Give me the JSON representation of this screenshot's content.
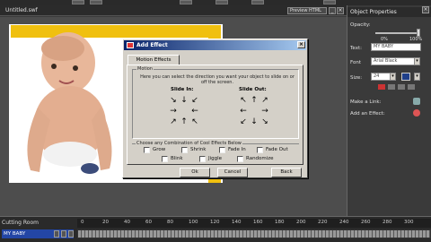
{
  "document": {
    "title": "Untitled.swf",
    "view_menu": "Preview HTML"
  },
  "dialog": {
    "title": "Add Effect",
    "tab": "Motion Effects",
    "motion_group": "Motion",
    "instructions": "Here you can select the direction you want your object to slide on or off the screen.",
    "slide_in": "Slide In:",
    "slide_out": "Slide Out:",
    "combine_group": "Choose any Combination of Cool Effects Below",
    "effects": [
      "Grow",
      "Shrink",
      "Fade In",
      "Fade Out",
      "Blink",
      "Jiggle",
      "Randomize"
    ],
    "buttons": {
      "ok": "Ok",
      "cancel": "Cancel",
      "back": "Back"
    }
  },
  "properties": {
    "title": "Object Properties",
    "opacity_label": "Opacity:",
    "opacity_min": "0%",
    "opacity_max": "100%",
    "opacity_percent": 100,
    "text_label": "Text:",
    "text_value": "MY BABY",
    "font_label": "Font",
    "font_value": "Arial Black",
    "size_label": "Size:",
    "size_value": "24",
    "color": "#1f3f8a",
    "make_link": "Make a Link:",
    "add_effect": "Add an Effect:"
  },
  "timeline": {
    "title": "Cutting Room",
    "track": "MY BABY",
    "ticks": [
      "0",
      "20",
      "40",
      "60",
      "80",
      "100",
      "120",
      "140",
      "160",
      "180",
      "200",
      "220",
      "240",
      "260",
      "280",
      "300"
    ]
  },
  "icons": {
    "link": "link-icon",
    "effect": "effect-icon",
    "close": "close-icon"
  }
}
